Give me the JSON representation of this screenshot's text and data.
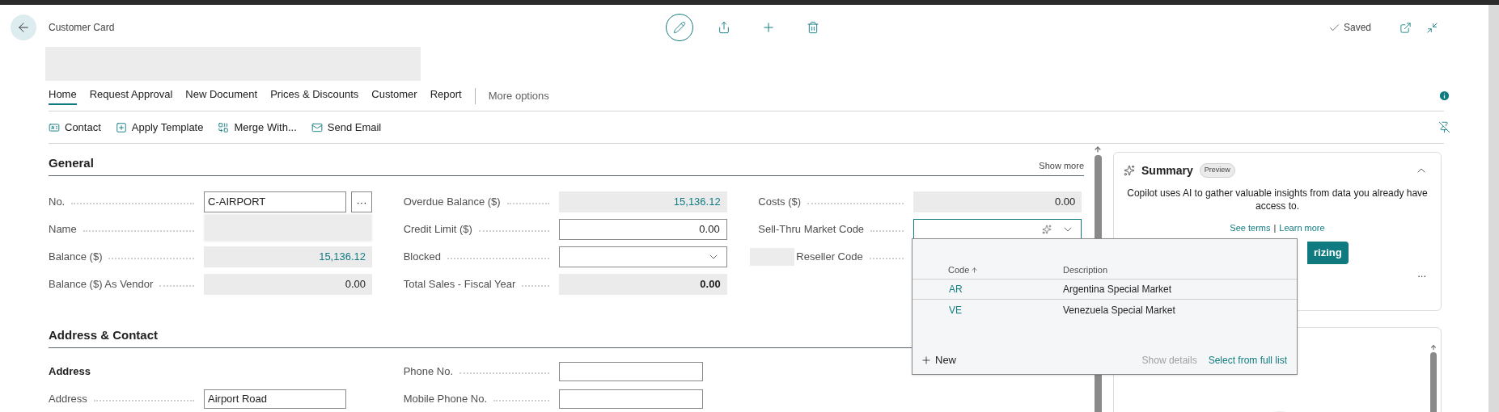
{
  "header": {
    "caption": "Customer Card",
    "status": "Saved"
  },
  "tabs": [
    {
      "label": "Home",
      "selected": true
    },
    {
      "label": "Request Approval",
      "selected": false
    },
    {
      "label": "New Document",
      "selected": false
    },
    {
      "label": "Prices & Discounts",
      "selected": false
    },
    {
      "label": "Customer",
      "selected": false
    },
    {
      "label": "Report",
      "selected": false
    }
  ],
  "more_options": "More options",
  "actions": [
    {
      "label": "Contact",
      "kind": "contact"
    },
    {
      "label": "Apply Template",
      "kind": "template"
    },
    {
      "label": "Merge With...",
      "kind": "merge"
    },
    {
      "label": "Send Email",
      "kind": "email"
    }
  ],
  "general": {
    "title": "General",
    "show_more": "Show more",
    "columns": [
      [
        {
          "label": "No.",
          "kind": "assist",
          "value": "C-AIRPORT",
          "button": "···"
        },
        {
          "label": "Name",
          "kind": "blurred"
        },
        {
          "label": "Balance ($)",
          "kind": "drilldown",
          "value": "15,136.12"
        },
        {
          "label": "Balance ($) As Vendor",
          "kind": "readonly",
          "value": "0.00"
        }
      ],
      [
        {
          "label": "Overdue Balance ($)",
          "kind": "drilldown",
          "value": "15,136.12"
        },
        {
          "label": "Credit Limit ($)",
          "kind": "input_number",
          "value": "0.00"
        },
        {
          "label": "Blocked",
          "kind": "dropdown"
        },
        {
          "label": "Total Sales - Fiscal Year",
          "kind": "readonly_bold",
          "value": "0.00"
        }
      ],
      [
        {
          "label": "Costs ($)",
          "kind": "readonly",
          "value": "0.00"
        },
        {
          "label": "Sell-Thru Market Code",
          "kind": "lookup_open"
        },
        {
          "label": "Reseller Code",
          "kind": "label_blurred"
        }
      ]
    ]
  },
  "lookup": {
    "columns": [
      {
        "label": "Code",
        "sorted": true
      },
      {
        "label": "Description",
        "sorted": false
      }
    ],
    "rows": [
      {
        "code": "AR",
        "description": "Argentina Special Market"
      },
      {
        "code": "VE",
        "description": "Venezuela Special Market"
      }
    ],
    "new": "New",
    "show_details": "Show details",
    "select_full": "Select from full list"
  },
  "address": {
    "title": "Address & Contact",
    "subheader": "Address",
    "left": [
      {
        "label": "Address",
        "value": "Airport Road"
      }
    ],
    "right": [
      {
        "label": "Phone No."
      },
      {
        "label": "Mobile Phone No."
      }
    ]
  },
  "summary": {
    "title": "Summary",
    "badge": "Preview",
    "text": "Copilot uses AI to gather valuable insights from data you already have access to.",
    "see_terms": "See terms",
    "separator": "|",
    "learn_more": "Learn more",
    "button": "rizing",
    "more": "..."
  }
}
